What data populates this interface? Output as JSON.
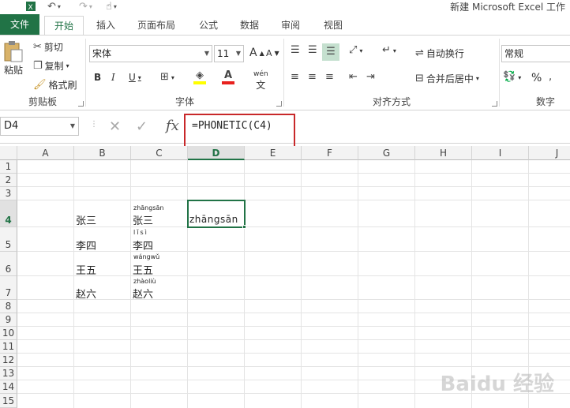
{
  "title": "新建 Microsoft Excel 工作",
  "tabs": {
    "file": "文件",
    "home": "开始",
    "insert": "插入",
    "layout": "页面布局",
    "formulas": "公式",
    "data": "数据",
    "review": "审阅",
    "view": "视图"
  },
  "clipboard": {
    "paste": "粘贴",
    "cut": "剪切",
    "copy": "复制",
    "format_painter": "格式刷",
    "label": "剪贴板"
  },
  "font": {
    "name": "宋体",
    "size": "11",
    "label": "字体",
    "grow": "A",
    "shrink": "A",
    "bold": "B",
    "italic": "I",
    "underline": "U",
    "phonetic": "wén"
  },
  "alignment": {
    "wrap": "自动换行",
    "merge": "合并后居中",
    "label": "对齐方式"
  },
  "number": {
    "format": "常规",
    "label": "数字",
    "percent": "%"
  },
  "name_box": "D4",
  "formula": "=PHONETIC(C4)",
  "fx": "fx",
  "columns": [
    "A",
    "B",
    "C",
    "D",
    "E",
    "F",
    "G",
    "H",
    "I",
    "J"
  ],
  "rows": [
    "1",
    "2",
    "3",
    "4",
    "5",
    "6",
    "7",
    "8",
    "9",
    "10",
    "11",
    "12",
    "13",
    "14",
    "15"
  ],
  "names": [
    {
      "text": "张三",
      "pinyin": "zhāngsān"
    },
    {
      "text": "李四",
      "pinyin": "lǐsì"
    },
    {
      "text": "王五",
      "pinyin": "wángwǔ"
    },
    {
      "text": "赵六",
      "pinyin": "zhàoliù"
    }
  ],
  "result": "zhāngsān",
  "watermark": "Baidu 经验",
  "colors": {
    "accent": "#217346",
    "highlight": "#c8282a"
  }
}
